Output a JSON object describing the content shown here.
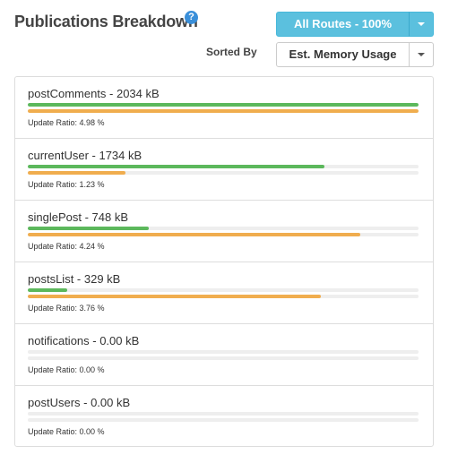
{
  "header": {
    "title": "Publications Breakdown",
    "help_icon": "?"
  },
  "route_select": {
    "label": "All Routes - 100%"
  },
  "sort": {
    "label": "Sorted By",
    "value": "Est. Memory Usage"
  },
  "colors": {
    "memory_bar": "#5cb85c",
    "update_bar": "#f0ad4e",
    "route_button": "#5bc0de"
  },
  "publications": [
    {
      "title": "postComments - 2034 kB",
      "memory_fraction": 1.0,
      "update_fraction": 1.0,
      "ratio": "Update Ratio: 4.98 %"
    },
    {
      "title": "currentUser - 1734 kB",
      "memory_fraction": 0.76,
      "update_fraction": 0.25,
      "ratio": "Update Ratio: 1.23 %"
    },
    {
      "title": "singlePost - 748 kB",
      "memory_fraction": 0.31,
      "update_fraction": 0.85,
      "ratio": "Update Ratio: 4.24 %"
    },
    {
      "title": "postsList - 329 kB",
      "memory_fraction": 0.1,
      "update_fraction": 0.75,
      "ratio": "Update Ratio: 3.76 %"
    },
    {
      "title": "notifications - 0.00 kB",
      "memory_fraction": 0.0,
      "update_fraction": 0.0,
      "ratio": "Update Ratio: 0.00 %"
    },
    {
      "title": "postUsers - 0.00 kB",
      "memory_fraction": 0.0,
      "update_fraction": 0.0,
      "ratio": "Update Ratio: 0.00 %"
    }
  ]
}
